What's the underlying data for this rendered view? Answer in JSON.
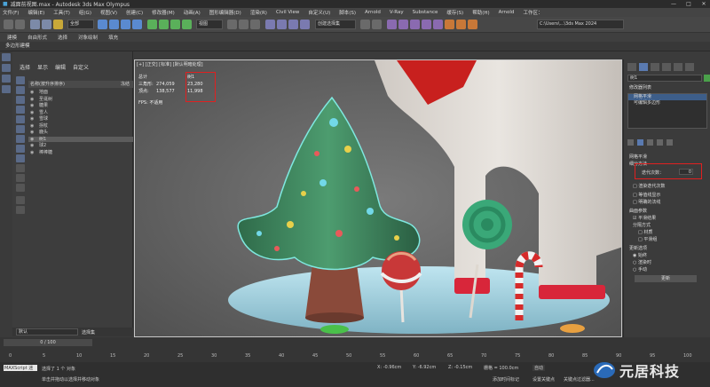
{
  "window": {
    "title": "减面前视图.max - Autodesk 3ds Max Olympus"
  },
  "menubar": {
    "items": [
      "文件(F)",
      "编辑(E)",
      "工具(T)",
      "组(G)",
      "视图(V)",
      "创建(C)",
      "修改器(M)",
      "动画(A)",
      "图形编辑器(D)",
      "渲染(R)",
      "Civil View",
      "自定义(U)",
      "脚本(S)",
      "Arnold",
      "V-Ray",
      "Substance",
      "缓存(S)",
      "帮助(H)",
      "Arnold",
      "工作区："
    ]
  },
  "toolbar": {
    "selection_filter": "全部",
    "view_dropdown": "视图",
    "named_sel": "创建选择集",
    "path": "C:\\Users\\...\\3ds Max 2024"
  },
  "toolbar2": {
    "items": [
      "建模",
      "自由形式",
      "选择",
      "对象绘制",
      "填充"
    ]
  },
  "ribbon": {
    "label": "多边形建模"
  },
  "scene_explorer": {
    "menu": [
      "选择",
      "显示",
      "编辑",
      "自定义"
    ],
    "header": "名称(按升序排序)",
    "header_right": "冻结",
    "rows": [
      {
        "name": "地面",
        "selected": false
      },
      {
        "name": "圣诞树",
        "selected": false
      },
      {
        "name": "糖果",
        "selected": false
      },
      {
        "name": "雪人",
        "selected": false
      },
      {
        "name": "雪球",
        "selected": false
      },
      {
        "name": "拐杖",
        "selected": false
      },
      {
        "name": "鹿头",
        "selected": false
      },
      {
        "name": "树1",
        "selected": true
      },
      {
        "name": "球2",
        "selected": false
      },
      {
        "name": "棒棒糖",
        "selected": false
      }
    ],
    "footer_dropdown": "默认",
    "footer_label": "选择集"
  },
  "viewport": {
    "label": "[+] [正交] [标准] [默认明暗处理]",
    "stats_labels": [
      "总计",
      "三角形:",
      "顶点:"
    ],
    "stats_total": [
      "274,059",
      "138,577"
    ],
    "stats_sel_header": "树1",
    "stats_sel": [
      "23,280",
      "11,998"
    ],
    "fps": "FPS: 不适用"
  },
  "command_panel": {
    "object_name": "树1",
    "modifier_list": "修改器列表",
    "stack": [
      "网格平滑",
      "可编辑多边形"
    ],
    "rollout_title": "网格平滑",
    "subdiv_method": "细分方法",
    "iterations_label": "迭代次数：",
    "iterations_value": "0",
    "render_iters": "渲染迭代次数",
    "options": [
      "平滑结果",
      "等值线显示",
      "明确的法线"
    ],
    "surface_params": "曲面参数",
    "smooth_result": "平滑结果",
    "sep": "分隔方式",
    "sep_opts": [
      "材质",
      "平滑组"
    ],
    "update_title": "更新选项",
    "update_opts": [
      "始终",
      "渲染时",
      "手动"
    ],
    "update_button": "更新"
  },
  "timeline": {
    "frame": "0 / 100",
    "ticks": [
      "0",
      "5",
      "10",
      "15",
      "20",
      "25",
      "30",
      "35",
      "40",
      "45",
      "50",
      "55",
      "60",
      "65",
      "70",
      "75",
      "80",
      "85",
      "90",
      "95",
      "100"
    ]
  },
  "status": {
    "maxscript": "MAXScript 迷你侦听器",
    "selected": "选择了 1 个 对象",
    "prompt": "单击并拖动以选择并移动对象",
    "x": "X: -0.96cm",
    "y": "Y: -6.92cm",
    "z": "Z: -0.15cm",
    "grid": "栅格 = 100.0cm",
    "time_tag": "添加时间标记",
    "autokey": "自动",
    "setkey": "设置关键点",
    "keyfilter": "关键点过滤器..."
  },
  "watermark": {
    "text": "元居科技"
  }
}
